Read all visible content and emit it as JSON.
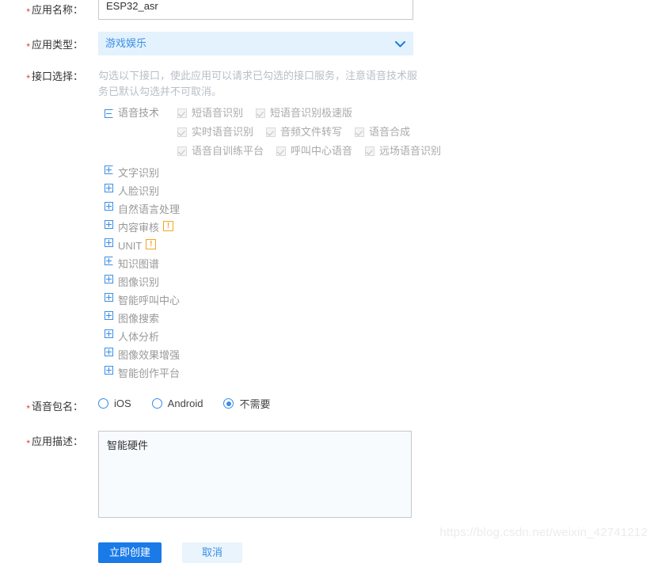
{
  "colors": {
    "accent": "#3a8ee6",
    "primary_button": "#1a7ae8",
    "secondary_button_bg": "#eaf4fd",
    "required_star": "#e4393c",
    "warning": "#f5a623",
    "hint_text": "#b8bfc7",
    "select_bg": "#e3f2fd",
    "textarea_bg": "#f7fbfd"
  },
  "form": {
    "app_name": {
      "label": "应用名称：",
      "required": true,
      "value": "ESP32_asr",
      "placeholder": ""
    },
    "app_type": {
      "label": "应用类型：",
      "required": true,
      "selected": "游戏娱乐",
      "caret_icon": "chevron-down-icon"
    },
    "api_selection": {
      "label": "接口选择：",
      "required": true,
      "hint": "勾选以下接口，使此应用可以请求已勾选的接口服务，注意语音技术服务已默认勾选并不可取消。",
      "expanded_group": {
        "name": "语音技术",
        "toggle_icon": "minus-square-icon",
        "rows": [
          [
            {
              "label": "短语音识别",
              "checked": true,
              "disabled": true
            },
            {
              "label": "短语音识别极速版",
              "checked": true,
              "disabled": true
            }
          ],
          [
            {
              "label": "实时语音识别",
              "checked": true,
              "disabled": true
            },
            {
              "label": "音频文件转写",
              "checked": true,
              "disabled": true
            },
            {
              "label": "语音合成",
              "checked": true,
              "disabled": true
            }
          ],
          [
            {
              "label": "语音自训练平台",
              "checked": true,
              "disabled": true
            },
            {
              "label": "呼叫中心语音",
              "checked": true,
              "disabled": true
            },
            {
              "label": "远场语音识别",
              "checked": true,
              "disabled": true
            }
          ]
        ]
      },
      "groups": [
        {
          "label": "文字识别",
          "toggle_icon": "plus-square-icon",
          "warning": false
        },
        {
          "label": "人脸识别",
          "toggle_icon": "plus-square-icon",
          "warning": false
        },
        {
          "label": "自然语言处理",
          "toggle_icon": "plus-square-icon",
          "warning": false
        },
        {
          "label": "内容审核",
          "toggle_icon": "plus-square-icon",
          "warning": true,
          "warning_text": "!"
        },
        {
          "label": "UNIT",
          "toggle_icon": "plus-square-icon",
          "warning": true,
          "warning_text": "!"
        },
        {
          "label": "知识图谱",
          "toggle_icon": "plus-square-icon",
          "warning": false
        },
        {
          "label": "图像识别",
          "toggle_icon": "plus-square-icon",
          "warning": false
        },
        {
          "label": "智能呼叫中心",
          "toggle_icon": "plus-square-icon",
          "warning": false
        },
        {
          "label": "图像搜索",
          "toggle_icon": "plus-square-icon",
          "warning": false
        },
        {
          "label": "人体分析",
          "toggle_icon": "plus-square-icon",
          "warning": false
        },
        {
          "label": "图像效果增强",
          "toggle_icon": "plus-square-icon",
          "warning": false
        },
        {
          "label": "智能创作平台",
          "toggle_icon": "plus-square-icon",
          "warning": false
        }
      ]
    },
    "voice_package": {
      "label": "语音包名：",
      "required": true,
      "options": [
        {
          "label": "iOS",
          "checked": false
        },
        {
          "label": "Android",
          "checked": false
        },
        {
          "label": "不需要",
          "checked": true
        }
      ]
    },
    "description": {
      "label": "应用描述：",
      "required": true,
      "value": "智能硬件",
      "placeholder": ""
    }
  },
  "actions": {
    "submit_label": "立即创建",
    "cancel_label": "取消"
  },
  "watermark": "https://blog.csdn.net/weixin_42741212"
}
